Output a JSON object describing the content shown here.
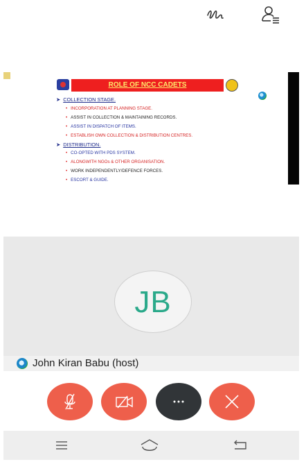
{
  "top_bar": {
    "annotate_icon": "squiggle-pen-icon",
    "participants_icon": "participant-list-icon"
  },
  "shared_slide": {
    "title": "ROLE OF NCC CADETS",
    "sections": [
      {
        "heading": "COLLECTION STAGE.",
        "items": [
          {
            "text": "INCORPORATION AT PLANNING STAGE.",
            "color": "#d52020"
          },
          {
            "text": "ASSIST IN COLLECTION & MAINTAINING RECORDS.",
            "color": "#222222"
          },
          {
            "text": "ASSIST IN DISPATCH OF ITEMS.",
            "color": "#2432a0"
          },
          {
            "text": "ESTABLISH OWN COLLECTION & DISTRIBUTION CENTRES.",
            "color": "#d52020"
          }
        ]
      },
      {
        "heading": "DISTRIBUTION.",
        "items": [
          {
            "text": "CO-OPTED WITH PDS SYSTEM.",
            "color": "#2432a0"
          },
          {
            "text": "ALONGWITH NGOs & OTHER ORGANISATION.",
            "color": "#d52020"
          },
          {
            "text": "WORK INDEPENDENTLY/DEFENCE FORCES.",
            "color": "#222222"
          },
          {
            "text": "ESCORT & GUIDE.",
            "color": "#2432a0"
          }
        ]
      }
    ]
  },
  "participant": {
    "initials": "JB",
    "name": "John Kiran Babu (host)"
  },
  "controls": {
    "mute": "microphone-muted-icon",
    "video": "video-off-icon",
    "more": "more-options-icon",
    "leave": "close-icon"
  },
  "colors": {
    "control_red": "#ee5f4b",
    "control_dark": "#313538",
    "avatar_text": "#2aa98a"
  }
}
